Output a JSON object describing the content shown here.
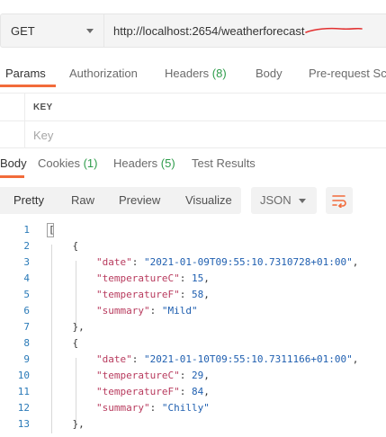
{
  "request": {
    "method": "GET",
    "url": "http://localhost:2654/weatherforecast"
  },
  "request_tabs": [
    {
      "label": "Params",
      "count": ""
    },
    {
      "label": "Authorization",
      "count": ""
    },
    {
      "label": "Headers",
      "count": "(8)"
    },
    {
      "label": "Body",
      "count": ""
    },
    {
      "label": "Pre-request Scr",
      "count": ""
    }
  ],
  "params": {
    "key_header": "KEY",
    "key_placeholder": "Key"
  },
  "response_tabs": [
    {
      "label": "Body",
      "count": ""
    },
    {
      "label": "Cookies",
      "count": "(1)"
    },
    {
      "label": "Headers",
      "count": "(5)"
    },
    {
      "label": "Test Results",
      "count": ""
    }
  ],
  "view_modes": [
    "Pretty",
    "Raw",
    "Preview",
    "Visualize"
  ],
  "format": "JSON",
  "code_lines": [
    {
      "n": "1",
      "parts": [
        [
          "p",
          "["
        ]
      ]
    },
    {
      "n": "2",
      "parts": [
        [
          "p",
          "    {"
        ]
      ]
    },
    {
      "n": "3",
      "parts": [
        [
          "p",
          "        "
        ],
        [
          "k",
          "\"date\""
        ],
        [
          "p",
          ": "
        ],
        [
          "s",
          "\"2021-01-09T09:55:10.7310728+01:00\""
        ],
        [
          "p",
          ","
        ]
      ]
    },
    {
      "n": "4",
      "parts": [
        [
          "p",
          "        "
        ],
        [
          "k",
          "\"temperatureC\""
        ],
        [
          "p",
          ": "
        ],
        [
          "n",
          "15"
        ],
        [
          "p",
          ","
        ]
      ]
    },
    {
      "n": "5",
      "parts": [
        [
          "p",
          "        "
        ],
        [
          "k",
          "\"temperatureF\""
        ],
        [
          "p",
          ": "
        ],
        [
          "n",
          "58"
        ],
        [
          "p",
          ","
        ]
      ]
    },
    {
      "n": "6",
      "parts": [
        [
          "p",
          "        "
        ],
        [
          "k",
          "\"summary\""
        ],
        [
          "p",
          ": "
        ],
        [
          "s",
          "\"Mild\""
        ]
      ]
    },
    {
      "n": "7",
      "parts": [
        [
          "p",
          "    },"
        ]
      ]
    },
    {
      "n": "8",
      "parts": [
        [
          "p",
          "    {"
        ]
      ]
    },
    {
      "n": "9",
      "parts": [
        [
          "p",
          "        "
        ],
        [
          "k",
          "\"date\""
        ],
        [
          "p",
          ": "
        ],
        [
          "s",
          "\"2021-01-10T09:55:10.7311166+01:00\""
        ],
        [
          "p",
          ","
        ]
      ]
    },
    {
      "n": "10",
      "parts": [
        [
          "p",
          "        "
        ],
        [
          "k",
          "\"temperatureC\""
        ],
        [
          "p",
          ": "
        ],
        [
          "n",
          "29"
        ],
        [
          "p",
          ","
        ]
      ]
    },
    {
      "n": "11",
      "parts": [
        [
          "p",
          "        "
        ],
        [
          "k",
          "\"temperatureF\""
        ],
        [
          "p",
          ": "
        ],
        [
          "n",
          "84"
        ],
        [
          "p",
          ","
        ]
      ]
    },
    {
      "n": "12",
      "parts": [
        [
          "p",
          "        "
        ],
        [
          "k",
          "\"summary\""
        ],
        [
          "p",
          ": "
        ],
        [
          "s",
          "\"Chilly\""
        ]
      ]
    },
    {
      "n": "13",
      "parts": [
        [
          "p",
          "    },"
        ]
      ]
    }
  ],
  "colors": {
    "accent": "#f26b3a",
    "count_green": "#2e9c4b",
    "json_key": "#b83b5e",
    "json_value": "#1f5fb0",
    "line_number": "#2a7ab8"
  }
}
